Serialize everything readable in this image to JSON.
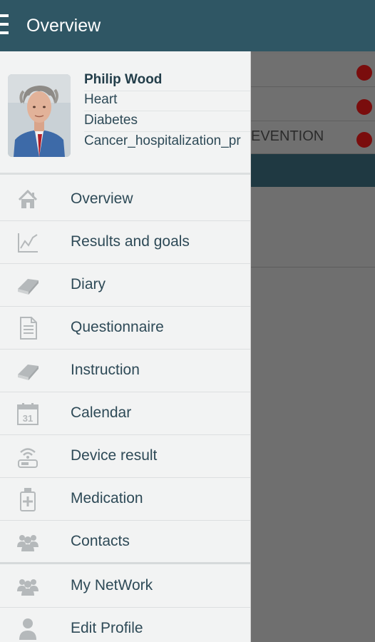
{
  "appbar": {
    "title": "Overview",
    "menu_icon": "hamburger-menu-icon",
    "color": "#2f5664"
  },
  "background": {
    "rows": [
      {
        "text": "",
        "status_color": "#7a0d0d"
      },
      {
        "text": "",
        "status_color": "#7a0d0d"
      },
      {
        "text": "EVENTION",
        "status_color": "#7a0d0d"
      }
    ]
  },
  "profile": {
    "name": "Philip Wood",
    "conditions": [
      "Heart",
      "Diabetes",
      "Cancer_hospitalization_pr"
    ],
    "avatar_icon": "user-photo"
  },
  "menu": [
    {
      "label": "Overview",
      "icon": "home-icon"
    },
    {
      "label": "Results and goals",
      "icon": "line-chart-icon"
    },
    {
      "label": "Diary",
      "icon": "book-icon"
    },
    {
      "label": "Questionnaire",
      "icon": "document-icon"
    },
    {
      "label": "Instruction",
      "icon": "book-icon"
    },
    {
      "label": "Calendar",
      "icon": "calendar-icon"
    },
    {
      "label": "Device result",
      "icon": "wireless-device-icon"
    },
    {
      "label": "Medication",
      "icon": "medication-bottle-icon"
    },
    {
      "label": "Contacts",
      "icon": "group-icon"
    },
    {
      "label": "My NetWork",
      "icon": "group-icon"
    },
    {
      "label": "Edit Profile",
      "icon": "person-icon"
    }
  ],
  "calendar_icon_day": "31",
  "colors": {
    "accent": "#2f5664",
    "text": "#2e4a57",
    "icon": "#b5b9bb",
    "status_dot": "#7a0d0d"
  }
}
